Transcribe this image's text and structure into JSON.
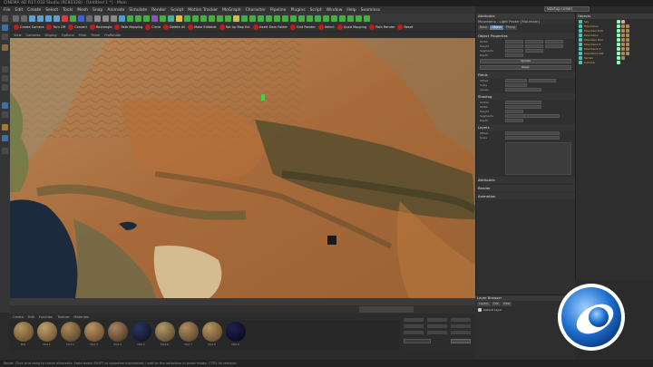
{
  "window": {
    "title": "CINEMA 4D R17.032 Studio (RC83328) - [Untitled 1 *] - Main"
  },
  "menubar": {
    "items": [
      "File",
      "Edit",
      "Create",
      "Select",
      "Tools",
      "Mesh",
      "Snap",
      "Animate",
      "Simulate",
      "Render",
      "Sculpt",
      "Motion Tracker",
      "MoGraph",
      "Character",
      "Pipeline",
      "Plugins",
      "Script",
      "Window",
      "Help",
      "Seamless"
    ],
    "layout_value": "Startup (User)"
  },
  "redbar": {
    "buttons": [
      "Create Camera",
      "Turn Off",
      "Convert",
      "Rectangle",
      "Path Mapping",
      "Circle",
      "Delete All",
      "Make Editable",
      "Set Up Map Ext",
      "Insert Dem Folder",
      "Grid Render",
      "Select",
      "Quad Mapping",
      "Path Render",
      "Reset"
    ]
  },
  "viewport_menu": {
    "items": [
      "View",
      "Cameras",
      "Display",
      "Options",
      "Filter",
      "Panel",
      "ProRender"
    ]
  },
  "materials": {
    "menu": [
      "Create",
      "Edit",
      "Function",
      "Texture",
      "Materials"
    ],
    "labels": [
      "Mat",
      "Mat.1",
      "Mat.2",
      "Mat.3",
      "Mat.4",
      "Mat.5",
      "Mat.6",
      "Mat.7",
      "Mat.8",
      "Mat.9"
    ],
    "colors": [
      [
        "#b5935f",
        "#5a4024"
      ],
      [
        "#c0a06a",
        "#5c4426"
      ],
      [
        "#a9895b",
        "#4a3720"
      ],
      [
        "#b79461",
        "#5a3e24"
      ],
      [
        "#a88460",
        "#3e2c1c"
      ],
      [
        "#2a3560",
        "#0a0d1e"
      ],
      [
        "#b49867",
        "#4d3a22"
      ],
      [
        "#ae8e60",
        "#4a3620"
      ],
      [
        "#b59562",
        "#583d23"
      ],
      [
        "#202050",
        "#050510"
      ]
    ]
  },
  "attributes": {
    "header": "Attributes",
    "title": "Mountains - Light Poster [Mountain]",
    "tabs": [
      "Basic",
      "Object",
      "Phong"
    ],
    "section": "Object Properties",
    "rows": [
      "Width",
      "Height",
      "Segments",
      "Depth",
      "Offset",
      "Scale",
      "Levels",
      "Global"
    ],
    "sub_sections": [
      "Fields",
      "Shading",
      "Layers",
      "Attributes",
      "Render",
      "Animation"
    ],
    "buttons": [
      "Update",
      "Reset"
    ]
  },
  "objects": {
    "header": "Objects",
    "items": [
      "Sky",
      "Mountains",
      "Mountain Edit",
      "Mountains",
      "Mountain Dist",
      "Mountains 2",
      "Mountains 3",
      "Mountains Ref",
      "Terrain",
      "Camera"
    ]
  },
  "layers": {
    "header": "Layer Browser",
    "tabs": [
      "Layers",
      "Edit",
      "View"
    ],
    "item": "Default Layer"
  },
  "colors": {
    "accent_blue": "#5b7fa6",
    "red_button": "#c41a1a",
    "object_teal": "#46c6b6"
  },
  "statusbar": {
    "text": "Move: Click and drag to move elements. Hold down SHIFT to quantize movement / add to the selection in point mode, CTRL to remove."
  }
}
